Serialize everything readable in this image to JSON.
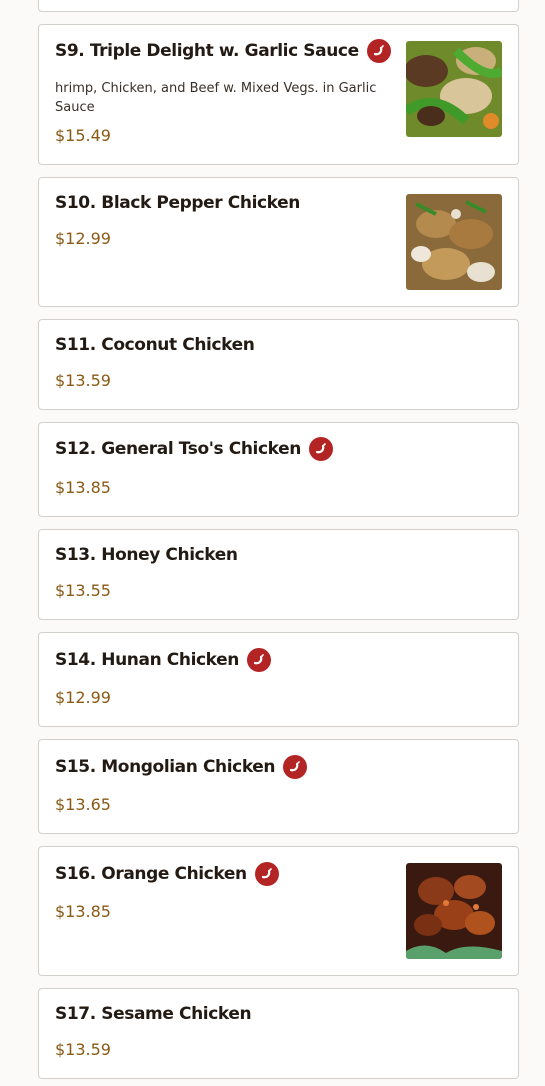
{
  "menu_items": [
    {
      "name": "S9. Triple Delight w. Garlic Sauce",
      "description": "hrimp, Chicken, and Beef w. Mixed Vegs. in Garlic Sauce",
      "price": "$15.49",
      "spicy": true,
      "image": "dish-photo"
    },
    {
      "name": "S10. Black Pepper Chicken",
      "price": "$12.99",
      "spicy": false,
      "image": "dish-photo"
    },
    {
      "name": "S11. Coconut Chicken",
      "price": "$13.59",
      "spicy": false
    },
    {
      "name": "S12. General Tso's Chicken",
      "price": "$13.85",
      "spicy": true
    },
    {
      "name": "S13. Honey Chicken",
      "price": "$13.55",
      "spicy": false
    },
    {
      "name": "S14. Hunan Chicken",
      "price": "$12.99",
      "spicy": true
    },
    {
      "name": "S15. Mongolian Chicken",
      "price": "$13.65",
      "spicy": true
    },
    {
      "name": "S16. Orange Chicken",
      "price": "$13.85",
      "spicy": true,
      "image": "dish-photo"
    },
    {
      "name": "S17. Sesame Chicken",
      "price": "$13.59",
      "spicy": false
    }
  ],
  "colors": {
    "price": "#8a5a14",
    "spicy_badge": "#b32424",
    "card_border": "#d3d0cc"
  }
}
